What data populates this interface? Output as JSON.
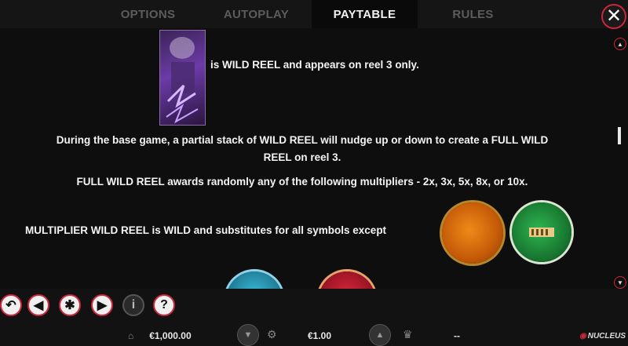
{
  "tabs": [
    {
      "label": "OPTIONS",
      "active": false
    },
    {
      "label": "AUTOPLAY",
      "active": false
    },
    {
      "label": "PAYTABLE",
      "active": true
    },
    {
      "label": "RULES",
      "active": false
    }
  ],
  "close_icon": "close-icon",
  "paytable": {
    "wild_reel_text": "is WILD REEL and appears on reel 3 only.",
    "base_game_line1": "During the base game, a partial stack of WILD REEL will nudge up or down to create a FULL WILD",
    "base_game_line2": "REEL on reel 3.",
    "multiplier_text": "FULL WILD REEL awards randomly any of the following multipliers - 2x, 3x, 5x, 8x, or 10x.",
    "substitute_text": "MULTIPLIER WILD REEL is WILD and substitutes for all symbols except"
  },
  "footer": {
    "balance": "€1,000.00",
    "bet": "€1.00",
    "win": "--",
    "brand": "NUCLEUS"
  },
  "colors": {
    "accent": "#c8283a",
    "orange_coin": "#e07a16",
    "green_coin": "#1e8a3a"
  }
}
